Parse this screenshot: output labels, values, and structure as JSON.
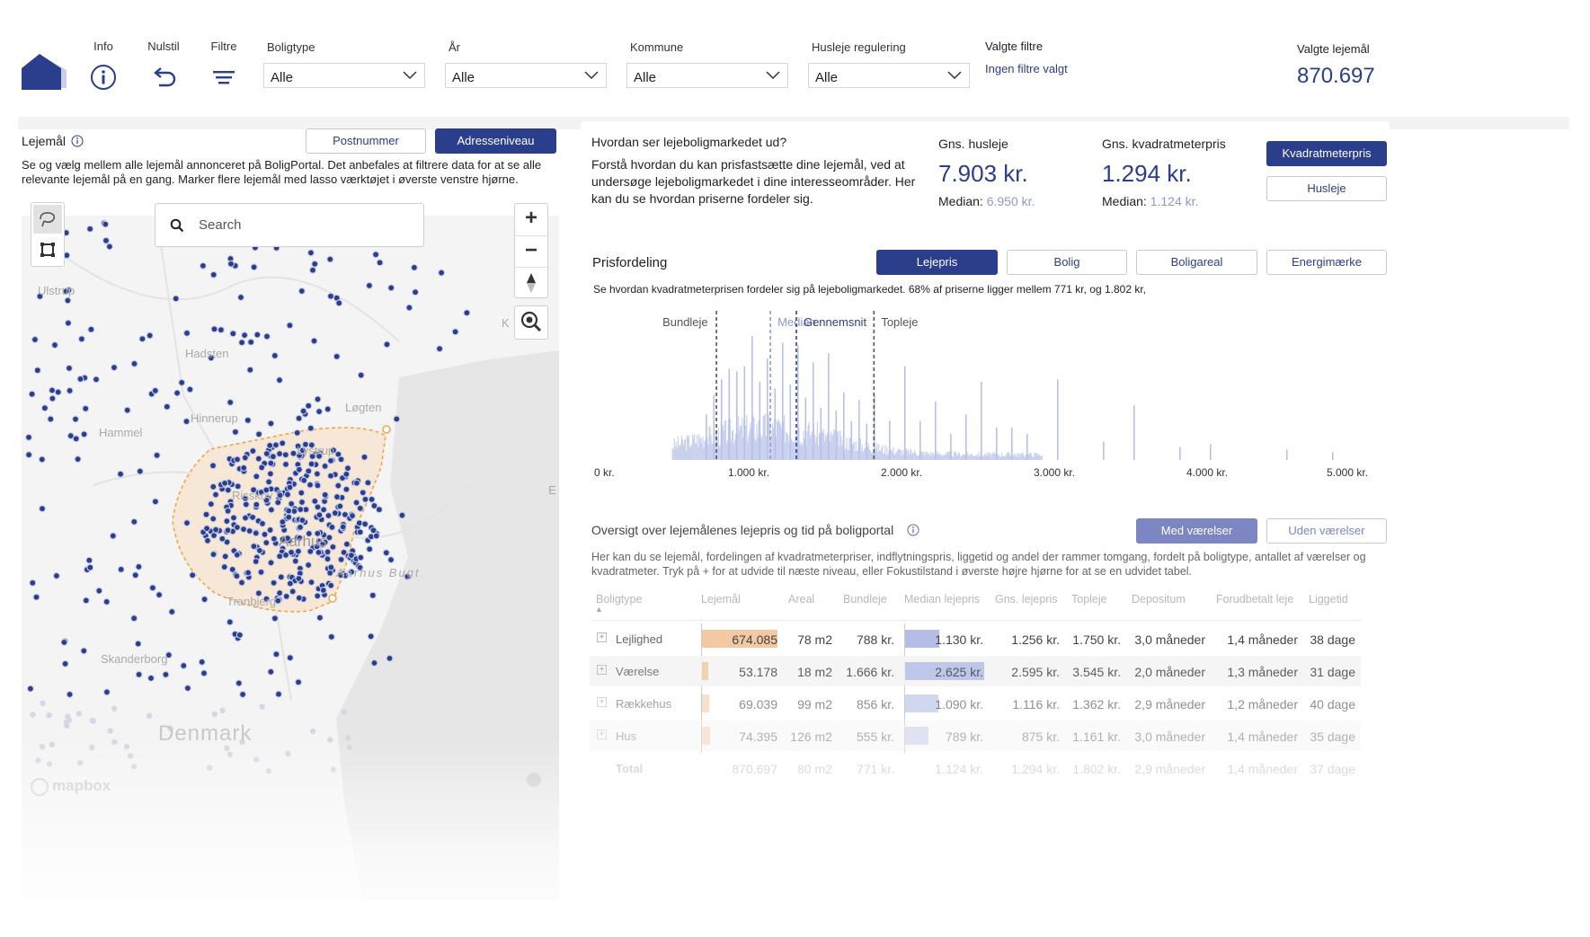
{
  "colors": {
    "accent": "#2a3e8c",
    "lasso": "#f0a64b",
    "bar_lejemaal": "#f2c9a3",
    "bar_median": "#b4bde6"
  },
  "toolbar": {
    "info_label": "Info",
    "reset_label": "Nulstil",
    "filter_label": "Filtre"
  },
  "filters": {
    "boligtype": {
      "label": "Boligtype",
      "value": "Alle"
    },
    "aar": {
      "label": "År",
      "value": "Alle"
    },
    "kommune": {
      "label": "Kommune",
      "value": "Alle"
    },
    "husleje": {
      "label": "Husleje regulering",
      "value": "Alle"
    }
  },
  "valgte_filtre": {
    "label": "Valgte filtre",
    "value": "Ingen filtre valgt"
  },
  "valgte_lejemaal": {
    "label": "Valgte lejemål",
    "value": "870.697"
  },
  "lejemaal_panel": {
    "title": "Lejemål",
    "btn_postnummer": "Postnummer",
    "btn_adresse": "Adresseniveau",
    "description": "Se og vælg mellem alle lejemål annonceret på BoligPortal. Det anbefales at filtrere data for at se alle relevante lejemål på en gang. Marker flere lejemål med lasso værktøjet i øverste venstre hjørne.",
    "search_placeholder": "Search",
    "zoom_in": "+",
    "zoom_out": "−",
    "attribution": "mapbox",
    "places": [
      "Ulstrup",
      "Hadsten",
      "Hinnerup",
      "Hammel",
      "Løgten",
      "Lystrup",
      "Risskov",
      "Aarhus",
      "Aarhus Bugt",
      "Tranbjerg",
      "Skanderborg",
      "Denmark",
      "K",
      "E"
    ]
  },
  "market": {
    "question": "Hvordan ser lejeboligmarkedet ud?",
    "text": "Forstå hvordan du kan prisfastsætte dine lejemål, ved at undersøge lejeboligmarkedet i dine interesseområder. Her kan du se hvordan priserne fordeler sig.",
    "avg_rent_label": "Gns. husleje",
    "avg_rent_value": "7.903 kr.",
    "median_rent_label": "Median:",
    "median_rent_value": "6.950 kr.",
    "avg_sqm_label": "Gns. kvadratmeterpris",
    "avg_sqm_value": "1.294 kr.",
    "median_sqm_label": "Median:",
    "median_sqm_value": "1.124 kr.",
    "btn_kvm": "Kvadratmeterpris",
    "btn_husleje": "Husleje"
  },
  "prisfordeling": {
    "title": "Prisfordeling",
    "tabs": [
      "Lejepris",
      "Bolig",
      "Boligareal",
      "Energimærke"
    ],
    "subtitle": "Se hvordan kvadratmeterprisen fordeler sig på lejeboligmarkedet. 68% af priserne ligger mellem 771 kr, og 1.802 kr,",
    "markers": [
      {
        "label": "Bundleje",
        "x": 771
      },
      {
        "label": "Median",
        "x": 1124
      },
      {
        "label": "Gennemsnit",
        "x": 1294
      },
      {
        "label": "Topleje",
        "x": 1802
      }
    ]
  },
  "chart_data": {
    "type": "bar",
    "xlim": [
      0,
      5000
    ],
    "xticks": [
      "0 kr.",
      "1.000 kr.",
      "2.000 kr.",
      "3.000 kr.",
      "4.000 kr.",
      "5.000 kr."
    ],
    "xtick_values": [
      0,
      1000,
      2000,
      3000,
      4000,
      5000
    ],
    "grid": false,
    "spikes": [
      {
        "x": 700,
        "y": 0.35
      },
      {
        "x": 750,
        "y": 0.5
      },
      {
        "x": 800,
        "y": 0.62
      },
      {
        "x": 850,
        "y": 0.7
      },
      {
        "x": 900,
        "y": 0.68
      },
      {
        "x": 950,
        "y": 0.72
      },
      {
        "x": 1000,
        "y": 0.95
      },
      {
        "x": 1050,
        "y": 0.6
      },
      {
        "x": 1100,
        "y": 0.78
      },
      {
        "x": 1150,
        "y": 0.55
      },
      {
        "x": 1200,
        "y": 0.9
      },
      {
        "x": 1250,
        "y": 0.58
      },
      {
        "x": 1300,
        "y": 0.88
      },
      {
        "x": 1350,
        "y": 0.48
      },
      {
        "x": 1400,
        "y": 0.75
      },
      {
        "x": 1450,
        "y": 0.4
      },
      {
        "x": 1500,
        "y": 0.82
      },
      {
        "x": 1550,
        "y": 0.38
      },
      {
        "x": 1600,
        "y": 0.52
      },
      {
        "x": 1650,
        "y": 0.3
      },
      {
        "x": 1700,
        "y": 0.46
      },
      {
        "x": 1750,
        "y": 0.28
      },
      {
        "x": 1800,
        "y": 0.5
      },
      {
        "x": 1900,
        "y": 0.3
      },
      {
        "x": 2000,
        "y": 0.72
      },
      {
        "x": 2100,
        "y": 0.3
      },
      {
        "x": 2200,
        "y": 0.45
      },
      {
        "x": 2300,
        "y": 0.2
      },
      {
        "x": 2400,
        "y": 0.35
      },
      {
        "x": 2500,
        "y": 0.6
      },
      {
        "x": 2600,
        "y": 0.25
      },
      {
        "x": 2700,
        "y": 0.25
      },
      {
        "x": 2800,
        "y": 0.2
      },
      {
        "x": 3000,
        "y": 0.62
      },
      {
        "x": 3300,
        "y": 0.14
      },
      {
        "x": 3500,
        "y": 0.42
      },
      {
        "x": 3800,
        "y": 0.1
      },
      {
        "x": 4000,
        "y": 0.12
      },
      {
        "x": 4500,
        "y": 0.08
      },
      {
        "x": 4800,
        "y": 0.06
      }
    ]
  },
  "oversigt": {
    "title": "Oversigt over lejemålenes lejepris og tid på boligportal",
    "btn_med": "Med værelser",
    "btn_uden": "Uden værelser",
    "description": "Her kan du se lejemål, fordelingen af kvadratmeterpriser, indflytningspris, liggetid og andel der rammer tomgang, fordelt på boligtype, antallet af værelser og kvadratmeter. Tryk på + for at udvide til næste niveau, eller Fokustilstand i øverste højre hjørne for at se en udvidet tabel.",
    "columns": [
      "Boligtype",
      "Lejemål",
      "Areal",
      "Bundleje",
      "Median lejepris",
      "Gns. lejepris",
      "Topleje",
      "Depositum",
      "Forudbetalt leje",
      "Liggetid"
    ],
    "rows": [
      {
        "type": "Lejlighed",
        "lejemaal": "674.085",
        "lejemaal_frac": 1.0,
        "areal": "78 m2",
        "bund": "788 kr.",
        "median": "1.130 kr.",
        "median_frac": 0.43,
        "gns": "1.256 kr.",
        "top": "1.750 kr.",
        "dep": "3,0 måneder",
        "forud": "1,4 måneder",
        "ligge": "38 dage"
      },
      {
        "type": "Værelse",
        "lejemaal": "53.178",
        "lejemaal_frac": 0.08,
        "areal": "18 m2",
        "bund": "1.666 kr.",
        "median": "2.625 kr.",
        "median_frac": 1.0,
        "gns": "2.595 kr.",
        "top": "3.545 kr.",
        "dep": "2,0 måneder",
        "forud": "1,3 måneder",
        "ligge": "31 dage"
      },
      {
        "type": "Rækkehus",
        "lejemaal": "69.039",
        "lejemaal_frac": 0.1,
        "areal": "99 m2",
        "bund": "856 kr.",
        "median": "1.090 kr.",
        "median_frac": 0.42,
        "gns": "1.116 kr.",
        "top": "1.362 kr.",
        "dep": "2,9 måneder",
        "forud": "1,2 måneder",
        "ligge": "40 dage"
      },
      {
        "type": "Hus",
        "lejemaal": "74.395",
        "lejemaal_frac": 0.11,
        "areal": "126 m2",
        "bund": "555 kr.",
        "median": "789 kr.",
        "median_frac": 0.3,
        "gns": "875 kr.",
        "top": "1.161 kr.",
        "dep": "3,0 måneder",
        "forud": "1,4 måneder",
        "ligge": "35 dage"
      }
    ],
    "total": {
      "type": "Total",
      "lejemaal": "870.697",
      "areal": "80 m2",
      "bund": "771 kr.",
      "median": "1.124 kr.",
      "gns": "1.294 kr.",
      "top": "1.802 kr.",
      "dep": "2,9 måneder",
      "forud": "1,4 måneder",
      "ligge": "37 dage"
    }
  }
}
